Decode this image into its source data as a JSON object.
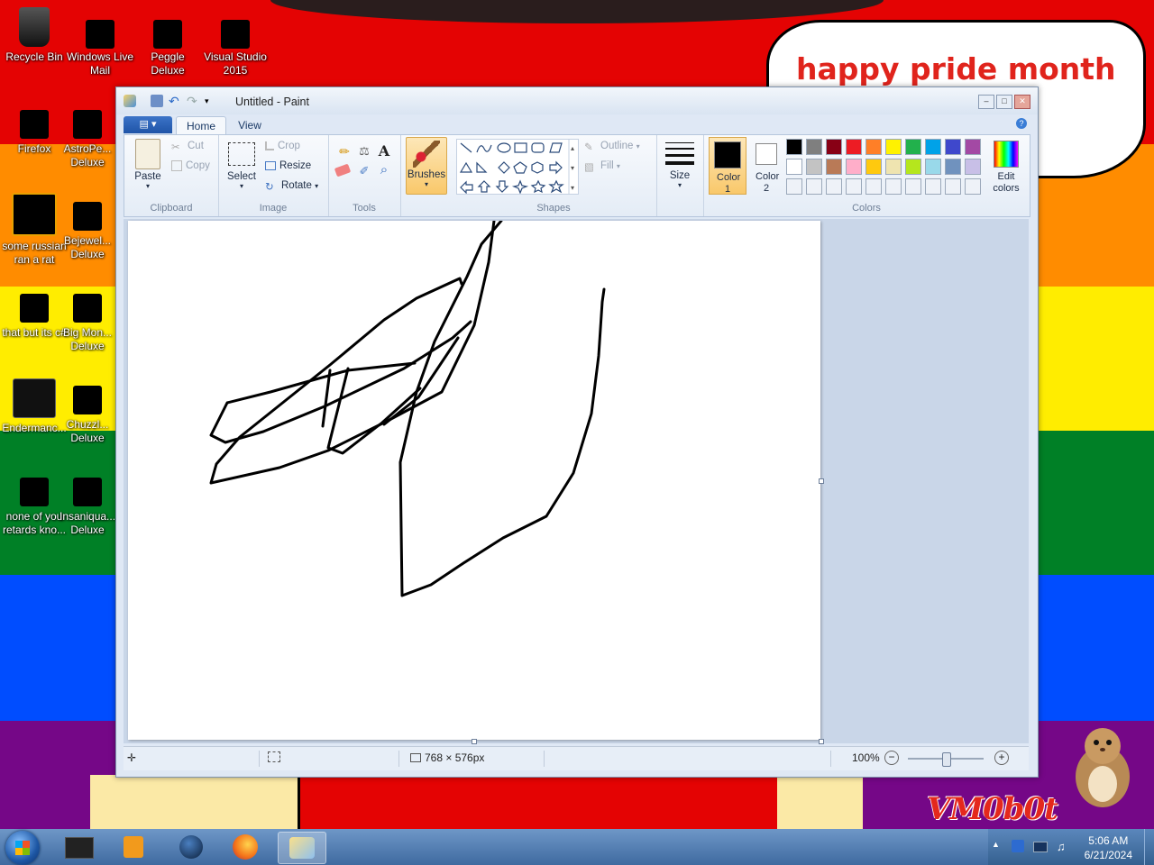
{
  "desktop": {
    "colors": [
      "#e40303",
      "#ff8c00",
      "#ffed00",
      "#008026",
      "#004dff",
      "#750787"
    ],
    "bubble_text": "happy pride month",
    "watermark": "VM0b0t",
    "icons": [
      {
        "label": "Recycle Bin"
      },
      {
        "label": "Windows Live Mail"
      },
      {
        "label": "Peggle Deluxe"
      },
      {
        "label": "Visual Studio 2015"
      },
      {
        "label": "Firefox"
      },
      {
        "label": "AstroPe... Deluxe"
      },
      {
        "label": "some russian ran a rat"
      },
      {
        "label": "Bejewel... Deluxe"
      },
      {
        "label": "that but its c#"
      },
      {
        "label": "Big Mon... Deluxe"
      },
      {
        "label": "Endermanc..."
      },
      {
        "label": "Chuzzl... Deluxe"
      },
      {
        "label": "none of you retards kno..."
      },
      {
        "label": "Insaniqua... Deluxe"
      }
    ]
  },
  "window": {
    "title": "Untitled - Paint",
    "tabs": {
      "file": "▤ ▾",
      "home": "Home",
      "view": "View"
    },
    "clipboard": {
      "paste": "Paste",
      "cut": "Cut",
      "copy": "Copy",
      "group": "Clipboard"
    },
    "image": {
      "select": "Select",
      "crop": "Crop",
      "resize": "Resize",
      "rotate": "Rotate",
      "group": "Image"
    },
    "tools": {
      "group": "Tools"
    },
    "brushes": {
      "label": "Brushes"
    },
    "shapes": {
      "outline": "Outline",
      "fill": "Fill",
      "group": "Shapes"
    },
    "size": {
      "label": "Size"
    },
    "colors": {
      "color1": "Color 1",
      "color2": "Color 2",
      "edit": "Edit colors",
      "group": "Colors",
      "palette_row1": [
        "#000000",
        "#7f7f7f",
        "#880015",
        "#ed1c24",
        "#ff7f27",
        "#fff200",
        "#22b14c",
        "#00a2e8",
        "#3f48cc",
        "#a349a4"
      ],
      "palette_row2": [
        "#ffffff",
        "#c3c3c3",
        "#b97a57",
        "#ffaec9",
        "#ffc90e",
        "#efe4b0",
        "#b5e61d",
        "#99d9ea",
        "#7092be",
        "#c8bfe7"
      ]
    },
    "status": {
      "size": "768 × 576px",
      "zoom": "100%"
    }
  },
  "taskbar": {
    "time": "5:06 AM",
    "date": "6/21/2024"
  }
}
